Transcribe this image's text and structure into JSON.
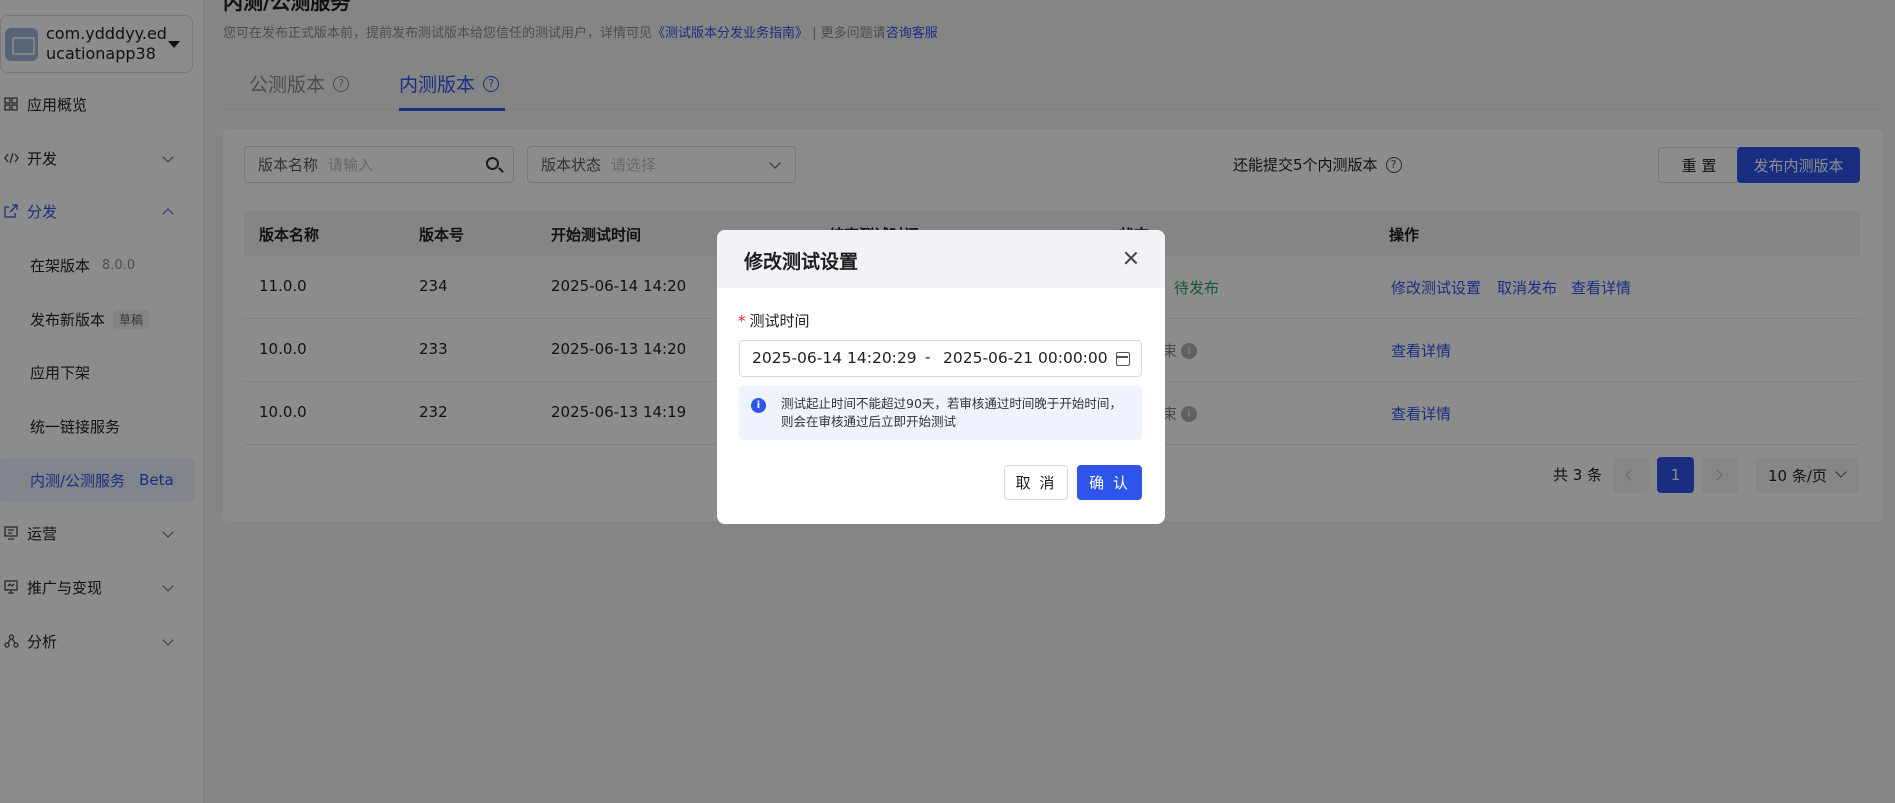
{
  "app": {
    "name": "com.ydddyy.educationapp38"
  },
  "sidebar": {
    "items": [
      {
        "label": "应用概览",
        "icon": "grid-icon"
      },
      {
        "label": "开发",
        "icon": "code-icon"
      },
      {
        "label": "分发",
        "icon": "share-icon"
      },
      {
        "label": "运营",
        "icon": "operate-icon"
      },
      {
        "label": "推广与变现",
        "icon": "monitor-icon"
      },
      {
        "label": "分析",
        "icon": "analysis-icon"
      }
    ],
    "sub_items": [
      {
        "label": "在架版本",
        "meta": "8.0.0"
      },
      {
        "label": "发布新版本",
        "tag": "草稿"
      },
      {
        "label": "应用下架"
      },
      {
        "label": "统一链接服务"
      },
      {
        "label": "内测/公测服务",
        "badge": "Beta"
      }
    ]
  },
  "page": {
    "title": "内测/公测服务",
    "desc_prefix": "您可在发布正式版本前，提前发布测试版本给您信任的测试用户，详情可见",
    "desc_link": "《测试版本分发业务指南》",
    "desc_middle": " | 更多问题请",
    "desc_link2": "咨询客服"
  },
  "tabs": [
    {
      "label": "公测版本"
    },
    {
      "label": "内测版本"
    }
  ],
  "filters": {
    "name": {
      "label": "版本名称",
      "placeholder": "请输入"
    },
    "status": {
      "label": "版本状态",
      "placeholder": "请选择"
    }
  },
  "quota_text": "还能提交5个内测版本",
  "buttons": {
    "reset": "重 置",
    "publish": "发布内测版本"
  },
  "table": {
    "columns": [
      "版本名称",
      "版本号",
      "开始测试时间",
      "结束测试时间",
      "状态",
      "操作"
    ],
    "rows": [
      {
        "name": "11.0.0",
        "code": "234",
        "start": "2025-06-14 14:20",
        "status": "功，待发布",
        "actions": [
          "修改测试设置",
          "取消发布",
          "查看详情"
        ]
      },
      {
        "name": "10.0.0",
        "code": "233",
        "start": "2025-06-13 14:20",
        "status": "束",
        "actions": [
          "查看详情"
        ]
      },
      {
        "name": "10.0.0",
        "code": "232",
        "start": "2025-06-13 14:19",
        "status": "束",
        "actions": [
          "查看详情"
        ]
      }
    ]
  },
  "pagination": {
    "total": "共 3 条",
    "current": "1",
    "page_size": "10 条/页"
  },
  "modal": {
    "title": "修改测试设置",
    "field_label": "测试时间",
    "start": "2025-06-14 14:20:29",
    "separator": "-",
    "end": "2025-06-21 00:00:00",
    "notice": "测试起止时间不能超过90天，若审核通过时间晚于开始时间，则会在审核通过后立即开始测试",
    "cancel": "取 消",
    "confirm": "确 认"
  },
  "colors": {
    "primary": "#2f54eb",
    "success": "#23a55a",
    "danger": "#f5222d"
  }
}
